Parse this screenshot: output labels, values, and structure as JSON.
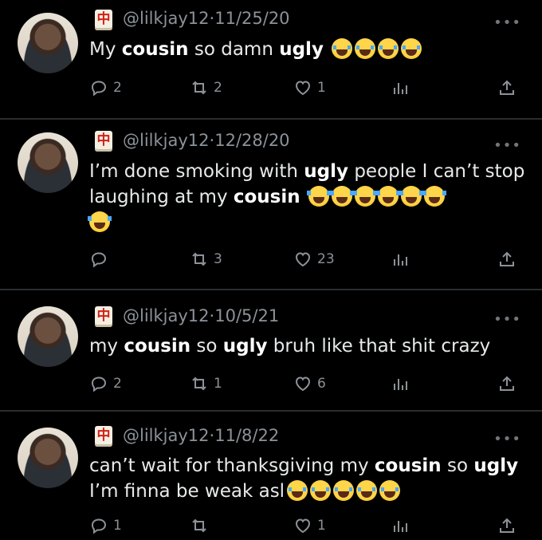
{
  "tweets": [
    {
      "handle": "@lilkjay12",
      "date": "11/25/20",
      "text_parts": [
        {
          "t": "My ",
          "b": false
        },
        {
          "t": "cousin",
          "b": true
        },
        {
          "t": " so damn ",
          "b": false
        },
        {
          "t": "ugly",
          "b": true
        }
      ],
      "emojis": [
        "crying-laughing",
        "crying-laughing",
        "crying-laughing",
        "crying-laughing"
      ],
      "replies": "2",
      "retweets": "2",
      "likes": "1"
    },
    {
      "handle": "@lilkjay12",
      "date": "12/28/20",
      "line1_parts": [
        {
          "t": "I’m done smoking with ",
          "b": false
        },
        {
          "t": "ugly",
          "b": true
        },
        {
          "t": " people I can’t stop",
          "b": false
        }
      ],
      "line2_parts": [
        {
          "t": "laughing at my ",
          "b": false
        },
        {
          "t": "cousin",
          "b": true
        }
      ],
      "emojis": [
        "tears-of-joy",
        "tears-of-joy",
        "tears-of-joy",
        "tears-of-joy",
        "tears-of-joy",
        "tears-of-joy",
        "tears-of-joy"
      ],
      "replies": "",
      "retweets": "3",
      "likes": "23"
    },
    {
      "handle": "@lilkjay12",
      "date": "10/5/21",
      "text_parts": [
        {
          "t": "my ",
          "b": false
        },
        {
          "t": "cousin",
          "b": true
        },
        {
          "t": " so ",
          "b": false
        },
        {
          "t": "ugly",
          "b": true
        },
        {
          "t": " bruh like that shit crazy",
          "b": false
        }
      ],
      "emojis": [],
      "replies": "2",
      "retweets": "1",
      "likes": "6"
    },
    {
      "handle": "@lilkjay12",
      "date": "11/8/22",
      "line1_parts": [
        {
          "t": "can’t wait for thanksgiving my ",
          "b": false
        },
        {
          "t": "cousin",
          "b": true
        },
        {
          "t": " so ",
          "b": false
        },
        {
          "t": "ugly",
          "b": true
        }
      ],
      "line2_parts": [
        {
          "t": "I’m finna be weak asl",
          "b": false
        }
      ],
      "emojis": [
        "crying-laughing",
        "crying-laughing",
        "crying-laughing",
        "crying-laughing",
        "crying-laughing"
      ],
      "replies": "1",
      "retweets": "",
      "likes": "1"
    }
  ],
  "separator": "·",
  "more_glyph": "•••",
  "badge_glyph": "中",
  "colors": {
    "background": "#000000",
    "text": "#e7e9ea",
    "muted": "#8b9299",
    "badge_red": "#d1221a"
  }
}
